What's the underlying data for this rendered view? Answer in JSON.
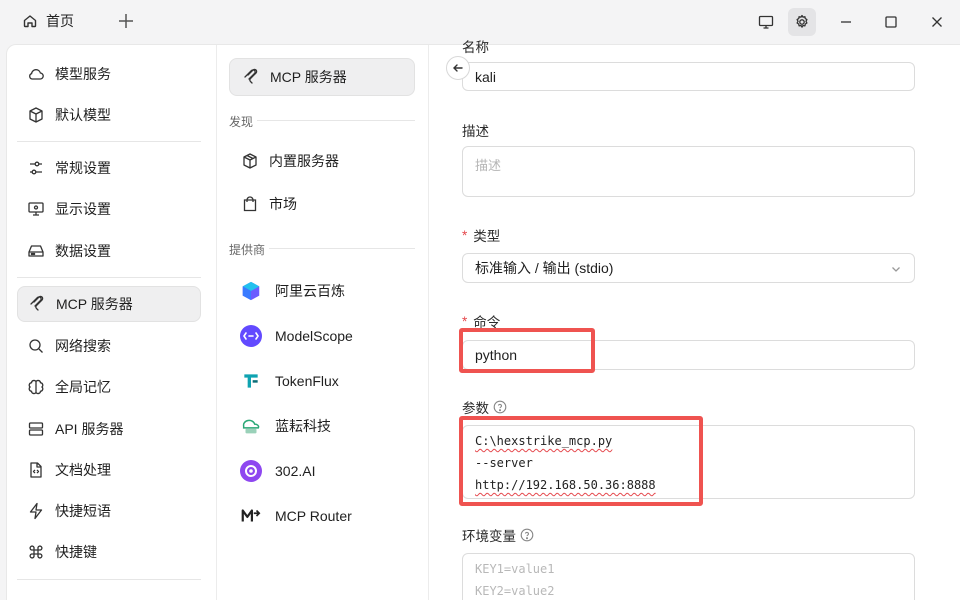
{
  "titlebar": {
    "home_tab": "首页",
    "icons": [
      "home-icon",
      "plus-icon",
      "monitor-icon",
      "gear-icon",
      "minimize-icon",
      "maximize-icon",
      "close-icon"
    ]
  },
  "nav": {
    "items": [
      {
        "label": "模型服务",
        "icon": "cloud-icon"
      },
      {
        "label": "默认模型",
        "icon": "cube-icon"
      },
      {
        "label": "常规设置",
        "icon": "sliders-icon"
      },
      {
        "label": "显示设置",
        "icon": "display-settings-icon"
      },
      {
        "label": "数据设置",
        "icon": "hard-drive-icon"
      },
      {
        "label": "MCP 服务器",
        "icon": "mcp-icon",
        "active": true
      },
      {
        "label": "网络搜索",
        "icon": "search-icon"
      },
      {
        "label": "全局记忆",
        "icon": "brain-icon"
      },
      {
        "label": "API 服务器",
        "icon": "server-icon"
      },
      {
        "label": "文档处理",
        "icon": "file-code-icon"
      },
      {
        "label": "快捷短语",
        "icon": "zap-icon"
      },
      {
        "label": "快捷键",
        "icon": "command-icon"
      }
    ]
  },
  "mcp_panel": {
    "top_item": "MCP 服务器",
    "discover_label": "发现",
    "discover_items": [
      {
        "label": "内置服务器",
        "icon": "package-icon"
      },
      {
        "label": "市场",
        "icon": "shopping-bag-icon"
      }
    ],
    "providers_label": "提供商",
    "providers": [
      {
        "label": "阿里云百炼",
        "icon": "bailian-logo-icon"
      },
      {
        "label": "ModelScope",
        "icon": "modelscope-logo-icon"
      },
      {
        "label": "TokenFlux",
        "icon": "tokenflux-logo-icon"
      },
      {
        "label": "蓝耘科技",
        "icon": "lanyun-logo-icon"
      },
      {
        "label": "302.AI",
        "icon": "ai302-logo-icon"
      },
      {
        "label": "MCP Router",
        "icon": "mcp-router-logo-icon"
      }
    ]
  },
  "form": {
    "name_label": "名称",
    "name_value": "kali",
    "desc_label": "描述",
    "desc_placeholder": "描述",
    "type_label": "类型",
    "type_value": "标准输入 / 输出 (stdio)",
    "command_label": "命令",
    "command_value": "python",
    "args_label": "参数",
    "args_lines": [
      "C:\\hexstrike_mcp.py",
      "--server",
      "http://192.168.50.36:8888"
    ],
    "env_label": "环境变量",
    "env_placeholder_lines": [
      "KEY1=value1",
      "KEY2=value2"
    ],
    "required_mark": "*"
  },
  "colors": {
    "highlight": "#ef5350",
    "required": "#e5484d",
    "active_bg": "#efeff0"
  }
}
